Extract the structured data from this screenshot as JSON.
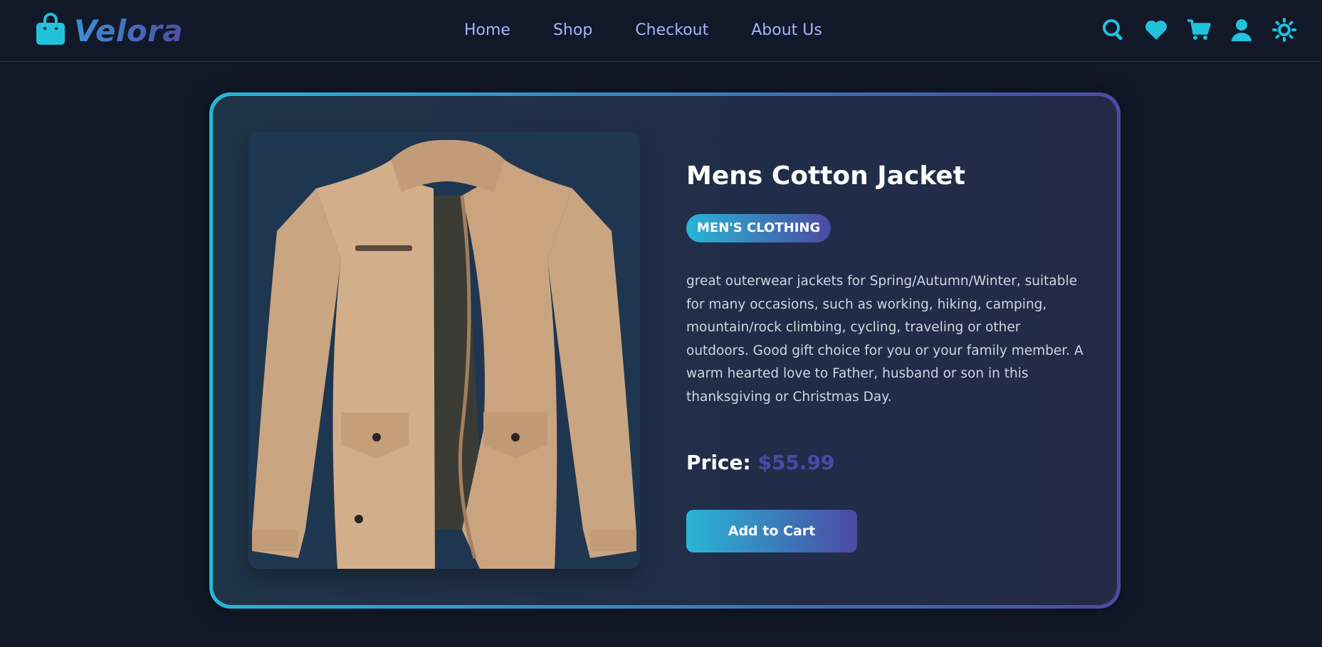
{
  "brand": {
    "name": "Velora",
    "logo_icon": "shopping-bag-icon"
  },
  "nav": {
    "items": [
      {
        "label": "Home"
      },
      {
        "label": "Shop"
      },
      {
        "label": "Checkout"
      },
      {
        "label": "About Us"
      }
    ]
  },
  "header_icons": [
    "search-icon",
    "heart-icon",
    "cart-icon",
    "user-icon",
    "sun-icon"
  ],
  "product": {
    "title": "Mens Cotton Jacket",
    "category": "MEN'S CLOTHING",
    "description": "great outerwear jackets for Spring/Autumn/Winter, suitable for many occasions, such as working, hiking, camping, mountain/rock climbing, cycling, traveling or other outdoors. Good gift choice for you or your family member. A warm hearted love to Father, husband or son in this thanksgiving or Christmas Day.",
    "price_label": "Price:",
    "price_value": "$55.99",
    "add_to_cart_label": "Add to Cart"
  },
  "colors": {
    "background": "#111827",
    "accent_cyan": "#22c1dc",
    "accent_indigo": "#4b4aa3",
    "nav_text": "#a5b4fc"
  }
}
